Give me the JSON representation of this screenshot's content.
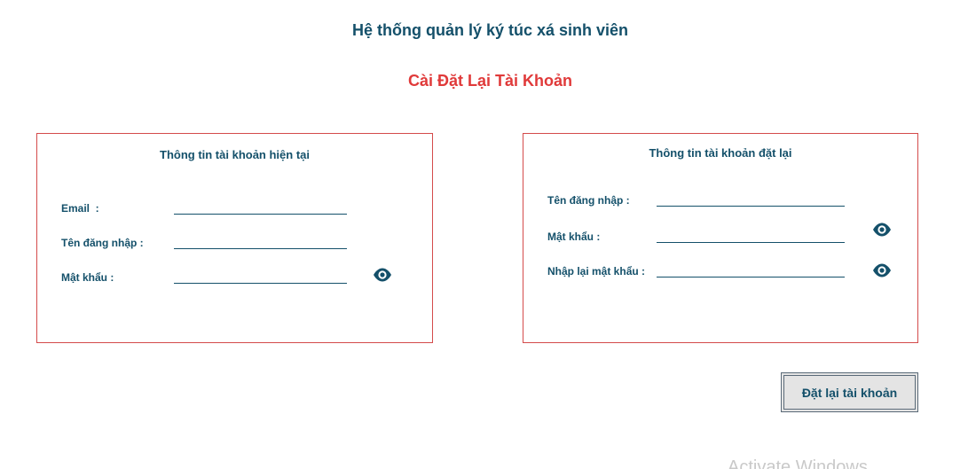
{
  "app": {
    "title": "Hệ thống quản lý ký túc xá sinh viên",
    "subtitle": "Cài Đặt Lại Tài Khoản"
  },
  "current_account": {
    "title": "Thông tin tài khoản hiện tại",
    "email_label": "Email  :",
    "email_value": "",
    "username_label": "Tên đăng nhập :",
    "username_value": "",
    "password_label": "Mật khẩu :",
    "password_value": "",
    "show_password_icon": "eye-icon"
  },
  "reset_account": {
    "title": "Thông tin tài khoản đặt lại",
    "username_label": "Tên đăng nhập :",
    "username_value": "",
    "password_label": "Mật khẩu :",
    "password_value": "",
    "confirm_label": "Nhập lại mật khẩu :",
    "confirm_value": "",
    "show_password_icon": "eye-icon"
  },
  "actions": {
    "reset_button_label": "Đặt lại tài khoản"
  },
  "watermark": {
    "text": "Activate Windows"
  },
  "colors": {
    "primary": "#14506a",
    "accent_red": "#e03a3a",
    "panel_border": "#d44b4b",
    "button_bg": "#e4e4e4"
  }
}
